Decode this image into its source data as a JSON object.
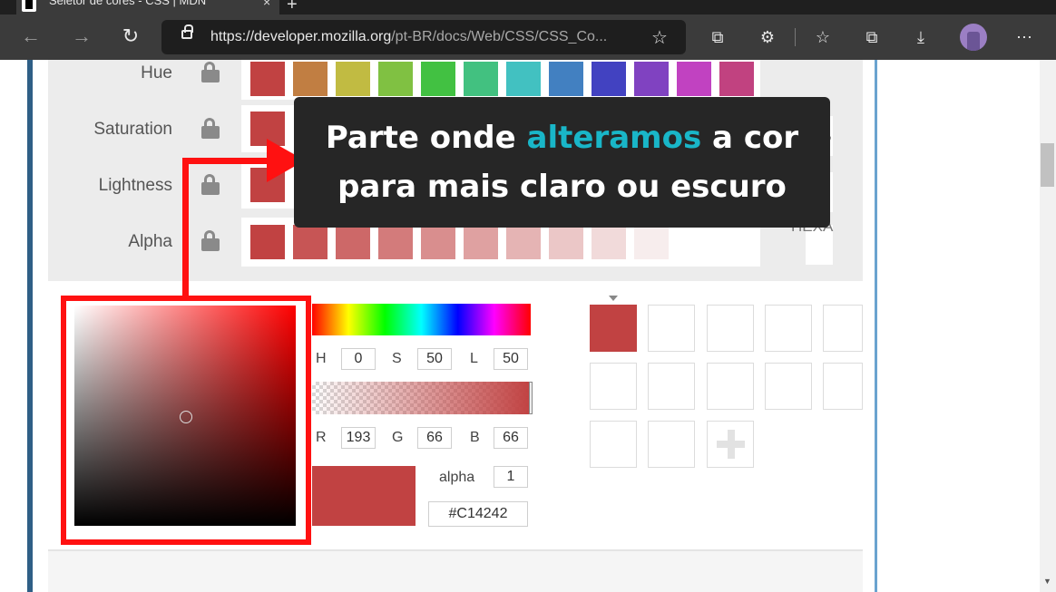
{
  "browser": {
    "tab_title": "Seletor de cores - CSS | MDN",
    "tab_close": "×",
    "new_tab": "+",
    "url_host": "https://developer.mozilla.org",
    "url_path": "/pt-BR/docs/Web/CSS/CSS_Co...",
    "icons": [
      "back-icon",
      "forward-icon",
      "refresh-icon",
      "lock-icon",
      "add-favorite-icon",
      "collections-icon",
      "extensions-icon",
      "favorites-icon",
      "tab-actions-icon",
      "downloads-icon",
      "profile-avatar",
      "more-icon"
    ]
  },
  "swatch_rows": [
    {
      "label": "Hue",
      "colors": [
        "#c14242",
        "#c17e42",
        "#c1bb42",
        "#80c142",
        "#42c142",
        "#42c180",
        "#42c1c1",
        "#4280c1",
        "#4242c1",
        "#8042c1",
        "#c142c1",
        "#c14280"
      ]
    },
    {
      "label": "Saturation",
      "colors": [
        "#c14242"
      ]
    },
    {
      "label": "Lightness",
      "colors": [
        "#c14242"
      ]
    },
    {
      "label": "Alpha",
      "colors": [
        "#c14242",
        "#c75555",
        "#cd6868",
        "#d37b7b",
        "#d98e8e",
        "#dfa1a1",
        "#e5b4b4",
        "#ebc7c7",
        "#f1dada",
        "#f7eded"
      ]
    }
  ],
  "side_letters": [
    "B",
    "L"
  ],
  "hexa_label": "HEXA",
  "picker": {
    "h_label": "H",
    "h_value": "0",
    "s_label": "S",
    "s_value": "50",
    "l_label": "L",
    "l_value": "50",
    "r_label": "R",
    "r_value": "193",
    "g_label": "G",
    "g_value": "66",
    "b_label": "B",
    "b_value": "66",
    "alpha_label": "alpha",
    "alpha_value": "1",
    "hex_value": "#C14242",
    "current_color": "#c14242"
  },
  "callout": {
    "line1_a": "Parte onde ",
    "line1_highlight": "alteramos",
    "line1_b": " a cor",
    "line2": "para mais claro ou escuro",
    "highlight_color": "#19b6c8"
  },
  "annotation_color": "#ff1111"
}
